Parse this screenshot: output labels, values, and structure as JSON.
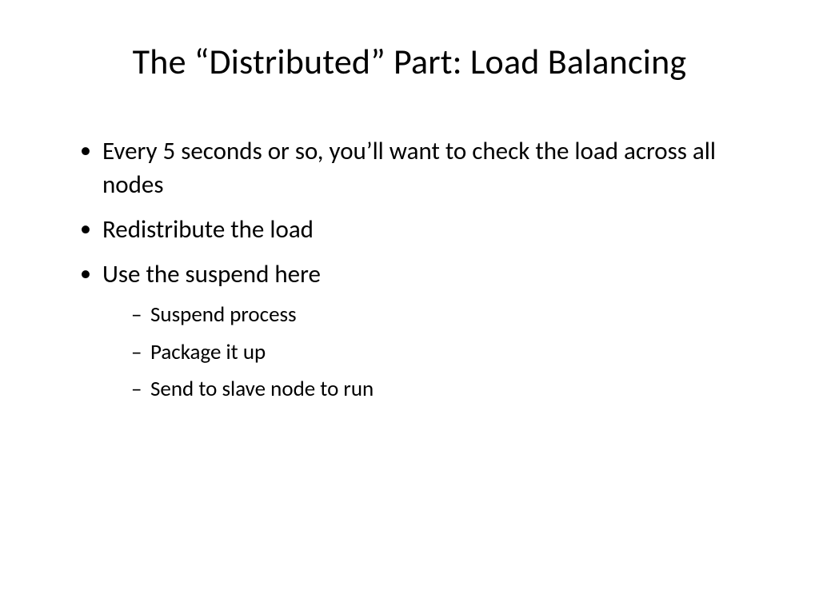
{
  "slide": {
    "title": "The “Distributed” Part: Load Balancing",
    "bullets": [
      {
        "text": "Every 5 seconds or so, you’ll want to check the load across all nodes",
        "children": []
      },
      {
        "text": "Redistribute the load",
        "children": []
      },
      {
        "text": "Use the suspend here",
        "children": [
          {
            "text": "Suspend process"
          },
          {
            "text": "Package it up"
          },
          {
            "text": "Send to slave node to run"
          }
        ]
      }
    ]
  }
}
